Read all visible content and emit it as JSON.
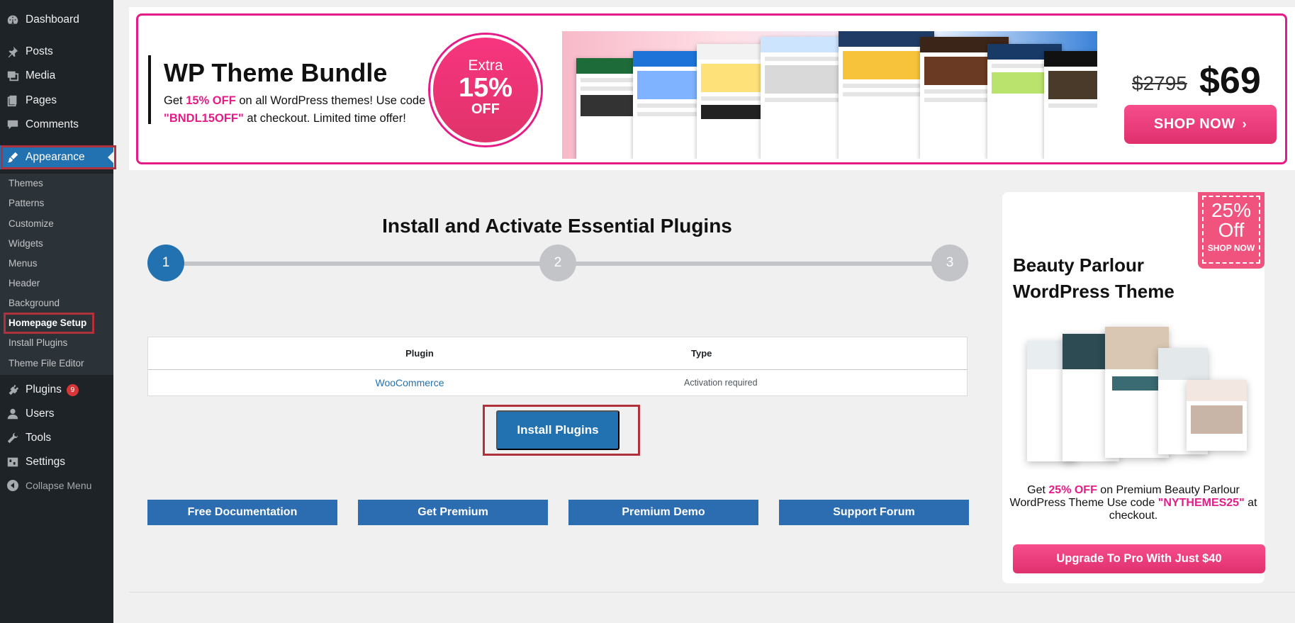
{
  "sidebar": {
    "items": [
      {
        "label": "Dashboard",
        "icon": "dashboard-icon"
      },
      {
        "label": "Posts",
        "icon": "pin-icon"
      },
      {
        "label": "Media",
        "icon": "media-icon"
      },
      {
        "label": "Pages",
        "icon": "pages-icon"
      },
      {
        "label": "Comments",
        "icon": "comments-icon"
      },
      {
        "label": "Appearance",
        "icon": "brush-icon"
      },
      {
        "label": "Plugins",
        "icon": "plugin-icon",
        "badge": "9"
      },
      {
        "label": "Users",
        "icon": "users-icon"
      },
      {
        "label": "Tools",
        "icon": "wrench-icon"
      },
      {
        "label": "Settings",
        "icon": "settings-icon"
      }
    ],
    "submenu": [
      "Themes",
      "Patterns",
      "Customize",
      "Widgets",
      "Menus",
      "Header",
      "Background",
      "Homepage Setup",
      "Install Plugins",
      "Theme File Editor"
    ],
    "collapse_label": "Collapse Menu"
  },
  "banner": {
    "title": "WP Theme Bundle",
    "text_before": "Get ",
    "highlight_discount": "15% OFF",
    "text_middle": " on all WordPress themes! Use code ",
    "code": "\"BNDL15OFF\"",
    "text_after": " at checkout. Limited time offer!",
    "circle_line1": "Extra",
    "circle_line2": "15%",
    "circle_line3": "OFF",
    "old_price": "$2795",
    "new_price": "$69",
    "shop_label": "SHOP NOW",
    "shop_chevron": "›"
  },
  "setup": {
    "title": "Install and Activate Essential Plugins",
    "steps": [
      "1",
      "2",
      "3"
    ],
    "table": {
      "headers": [
        "Plugin",
        "Type"
      ],
      "rows": [
        {
          "plugin": "WooCommerce",
          "type": "Activation required"
        }
      ]
    },
    "install_label": "Install Plugins",
    "links": [
      "Free Documentation",
      "Get Premium",
      "Premium Demo",
      "Support Forum"
    ]
  },
  "promo": {
    "tag_line1": "25%",
    "tag_line2": "Off",
    "tag_line3": "SHOP NOW",
    "title": "Beauty Parlour WordPress Theme",
    "text_before": "Get ",
    "discount": "25% OFF",
    "text_middle": " on Premium Beauty Parlour WordPress Theme Use code ",
    "code": "\"NYTHEMES25\"",
    "text_after": " at checkout.",
    "button_label": "Upgrade To Pro With Just $40"
  },
  "colors": {
    "sidebar_bg": "#1d2327",
    "accent_blue": "#2271b1",
    "brand_pink": "#e51c88",
    "highlight_red": "#b0303b"
  }
}
